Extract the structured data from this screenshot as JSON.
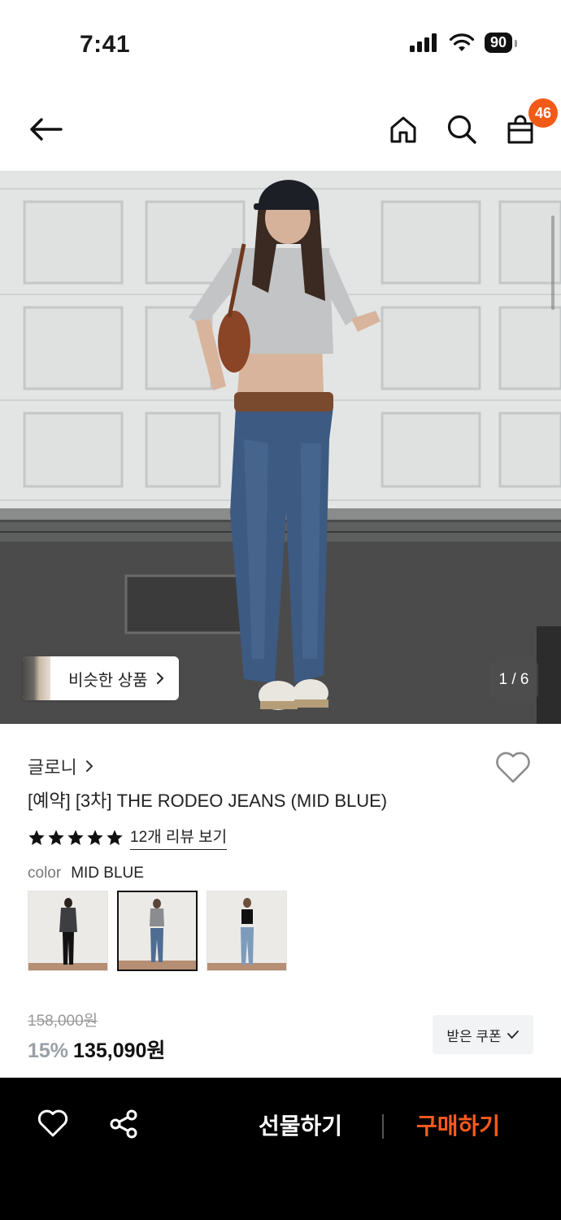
{
  "status_bar": {
    "time": "7:41",
    "battery": "90"
  },
  "header": {
    "cart_count": "46"
  },
  "gallery": {
    "similar_label": "비슷한 상품",
    "pager": "1 / 6"
  },
  "product": {
    "brand": "글로니",
    "title": "[예약] [3차] THE RODEO JEANS (MID BLUE)",
    "rating_stars": 5,
    "review_link": "12개 리뷰 보기",
    "color_label": "color",
    "color_value": "MID BLUE",
    "swatch_count": 3,
    "selected_swatch": 2,
    "original_price": "158,000원",
    "discount": "15%",
    "final_price": "135,090원",
    "coupon_label": "받은 쿠폰"
  },
  "bottom_bar": {
    "gift_label": "선물하기",
    "buy_label": "구매하기"
  },
  "colors": {
    "accent": "#ff5a1f",
    "badge": "#f25a18",
    "bottom_bar_bg": "#000000"
  }
}
